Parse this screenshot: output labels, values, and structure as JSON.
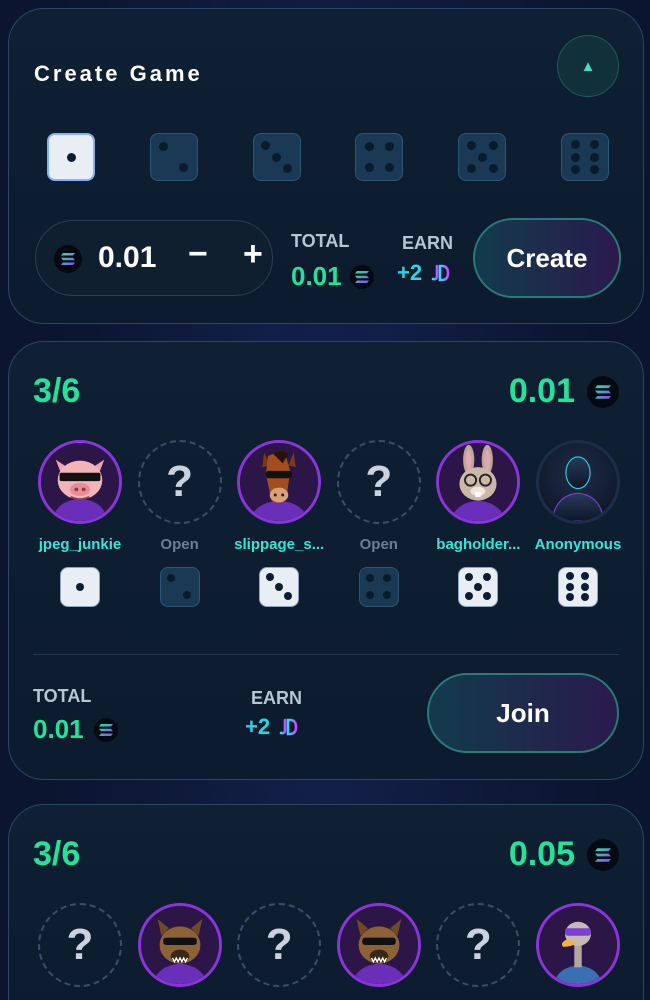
{
  "create": {
    "title": "Create Game",
    "collapse_icon": "▲",
    "amount": "0.01",
    "minus": "−",
    "plus": "+",
    "total_label": "TOTAL",
    "total_value": "0.01",
    "earn_label": "EARN",
    "earn_value": "+2",
    "create_label": "Create",
    "dice": [
      1,
      2,
      3,
      4,
      5,
      6
    ],
    "selected_die": 1
  },
  "games": [
    {
      "count": "3/6",
      "stake": "0.01",
      "players": [
        {
          "name": "jpeg_junkie",
          "type": "pig",
          "die": 1
        },
        {
          "name": "Open",
          "type": "open",
          "die": 2
        },
        {
          "name": "slippage_s...",
          "type": "horse",
          "die": 3
        },
        {
          "name": "Open",
          "type": "open",
          "die": 4
        },
        {
          "name": "bagholder...",
          "type": "rabbit",
          "die": 5
        },
        {
          "name": "Anonymous",
          "type": "anon",
          "die": 6
        }
      ],
      "total_label": "TOTAL",
      "total_value": "0.01",
      "earn_label": "EARN",
      "earn_value": "+2",
      "join_label": "Join"
    },
    {
      "count": "3/6",
      "stake": "0.05",
      "players": [
        {
          "name": "",
          "type": "open"
        },
        {
          "name": "",
          "type": "hyena"
        },
        {
          "name": "",
          "type": "open"
        },
        {
          "name": "",
          "type": "hyena"
        },
        {
          "name": "",
          "type": "open"
        },
        {
          "name": "",
          "type": "ostrich"
        }
      ]
    }
  ],
  "colors": {
    "accent_green": "#22e39a",
    "accent_cyan": "#34e6d8",
    "avatar_ring": "#8a35d8"
  },
  "icons": {
    "solana": "solana-icon",
    "earn_token": "token-jd-icon",
    "open_slot": "question-mark-icon"
  }
}
